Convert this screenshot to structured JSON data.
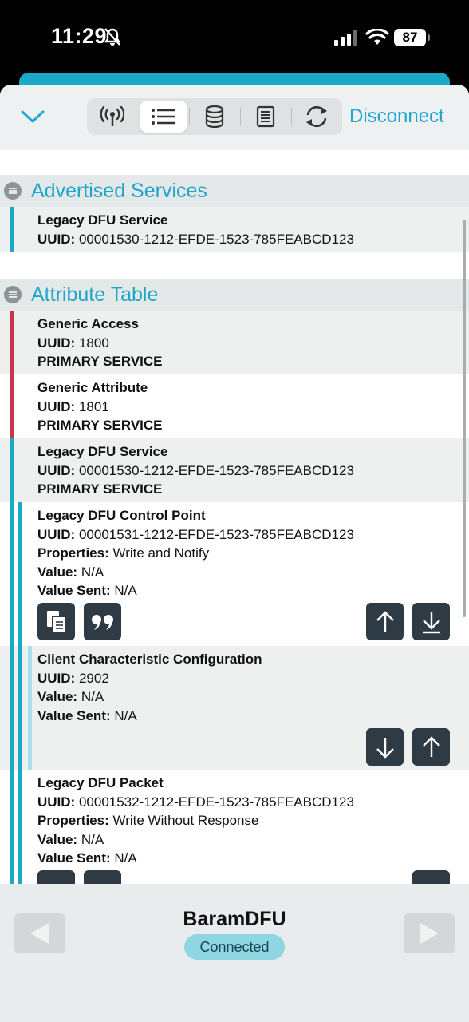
{
  "status": {
    "time": "11:29",
    "battery": "87"
  },
  "toolbar": {
    "disconnect_label": "Disconnect",
    "tabs": [
      {
        "icon": "antenna-icon",
        "active": false
      },
      {
        "icon": "list-icon",
        "active": true
      },
      {
        "icon": "database-icon",
        "active": false
      },
      {
        "icon": "log-icon",
        "active": false
      },
      {
        "icon": "refresh-icon",
        "active": false
      }
    ]
  },
  "advertised": {
    "title": "Advertised Services",
    "items": [
      {
        "name": "Legacy DFU Service",
        "uuid_label": "UUID:",
        "uuid": "00001530-1212-EFDE-1523-785FEABCD123"
      }
    ]
  },
  "attributes": {
    "title": "Attribute Table",
    "labels": {
      "uuid": "UUID:",
      "properties": "Properties:",
      "value": "Value:",
      "value_sent": "Value Sent:"
    },
    "services": [
      {
        "name": "Generic Access",
        "uuid": "1800",
        "type": "PRIMARY SERVICE"
      },
      {
        "name": "Generic Attribute",
        "uuid": "1801",
        "type": "PRIMARY SERVICE"
      },
      {
        "name": "Legacy DFU Service",
        "uuid": "00001530-1212-EFDE-1523-785FEABCD123",
        "type": "PRIMARY SERVICE"
      }
    ],
    "characteristics": [
      {
        "name": "Legacy DFU Control Point",
        "uuid": "00001531-1212-EFDE-1523-785FEABCD123",
        "properties": "Write and Notify",
        "value": "N/A",
        "value_sent": "N/A"
      },
      {
        "name": "Client Characteristic Configuration",
        "uuid": "2902",
        "value": "N/A",
        "value_sent": "N/A"
      },
      {
        "name": "Legacy DFU Packet",
        "uuid": "00001532-1212-EFDE-1523-785FEABCD123",
        "properties": "Write Without Response",
        "value": "N/A",
        "value_sent": "N/A"
      }
    ]
  },
  "footer": {
    "device_name": "BaramDFU",
    "status": "Connected"
  },
  "colors": {
    "accent": "#1ea6c9",
    "service_red": "#c8354f",
    "service_teal": "#1ba9c8",
    "button_dark": "#2e3b44"
  }
}
